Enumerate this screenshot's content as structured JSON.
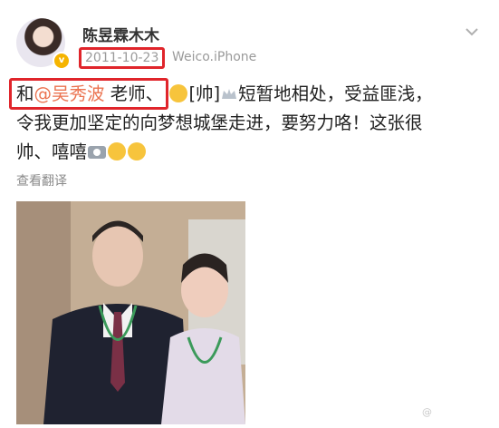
{
  "post": {
    "username": "陈昱霖木木",
    "date": "2011-10-23",
    "source": "Weico.iPhone",
    "text": {
      "prefix": "和",
      "mention": "@吴秀波",
      "title": " 老师、",
      "tag": "[帅]",
      "line1_rest": "短暂地相处，受益匪浅，",
      "line2": "令我更加坚定的向梦想城堡走进，要努力咯！这张很",
      "line3": "帅、嘻嘻"
    },
    "translate_label": "查看翻译",
    "photo_alt": "合影照片",
    "icons": [
      "chevron-down-icon",
      "verified-badge-icon",
      "smile-emoji",
      "crown-emoji",
      "camera-emoji"
    ]
  },
  "colors": {
    "highlight": "#e0252b",
    "mention": "#eb7350",
    "meta": "#9a9a9a"
  }
}
